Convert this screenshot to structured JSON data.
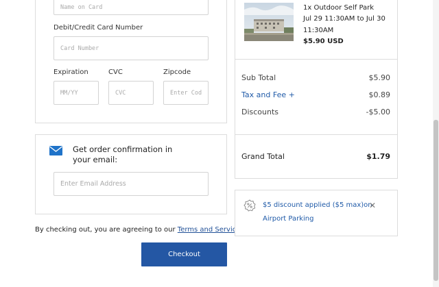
{
  "payment": {
    "name_placeholder": "Name on Card",
    "card_label": "Debit/Credit Card Number",
    "card_placeholder": "Card Number",
    "expiration_label": "Expiration",
    "expiration_placeholder": "MM/YY",
    "cvc_label": "CVC",
    "cvc_placeholder": "CVC",
    "zip_label": "Zipcode",
    "zip_placeholder": "Enter Cod"
  },
  "confirmation": {
    "title_line1": "Get order confirmation in",
    "title_line2": "your email:",
    "email_placeholder": "Enter Email Address",
    "icon": "envelope-icon"
  },
  "agreement": {
    "prefix": "By checking out, you are agreeing to our ",
    "link_text": "Terms and Services"
  },
  "checkout_button": "Checkout",
  "order": {
    "item_line1": "1x Outdoor Self Park",
    "item_line2": "Jul 29 11:30AM to Jul 30",
    "item_line3": "11:30AM",
    "item_price": "$5.90 USD",
    "subtotal_label": "Sub Total",
    "subtotal_value": "$5.90",
    "tax_label": "Tax and Fee +",
    "tax_value": "$0.89",
    "discounts_label": "Discounts",
    "discounts_value": "-$5.00",
    "grand_total_label": "Grand Total",
    "grand_total_value": "$1.79"
  },
  "discount_notice": {
    "line1": "$5 discount applied ($5 max)on",
    "line2": "Airport Parking",
    "icon": "discount-badge-icon",
    "close_icon": "close-icon"
  },
  "colors": {
    "accent": "#2457a4",
    "link": "#1f5aa8"
  }
}
